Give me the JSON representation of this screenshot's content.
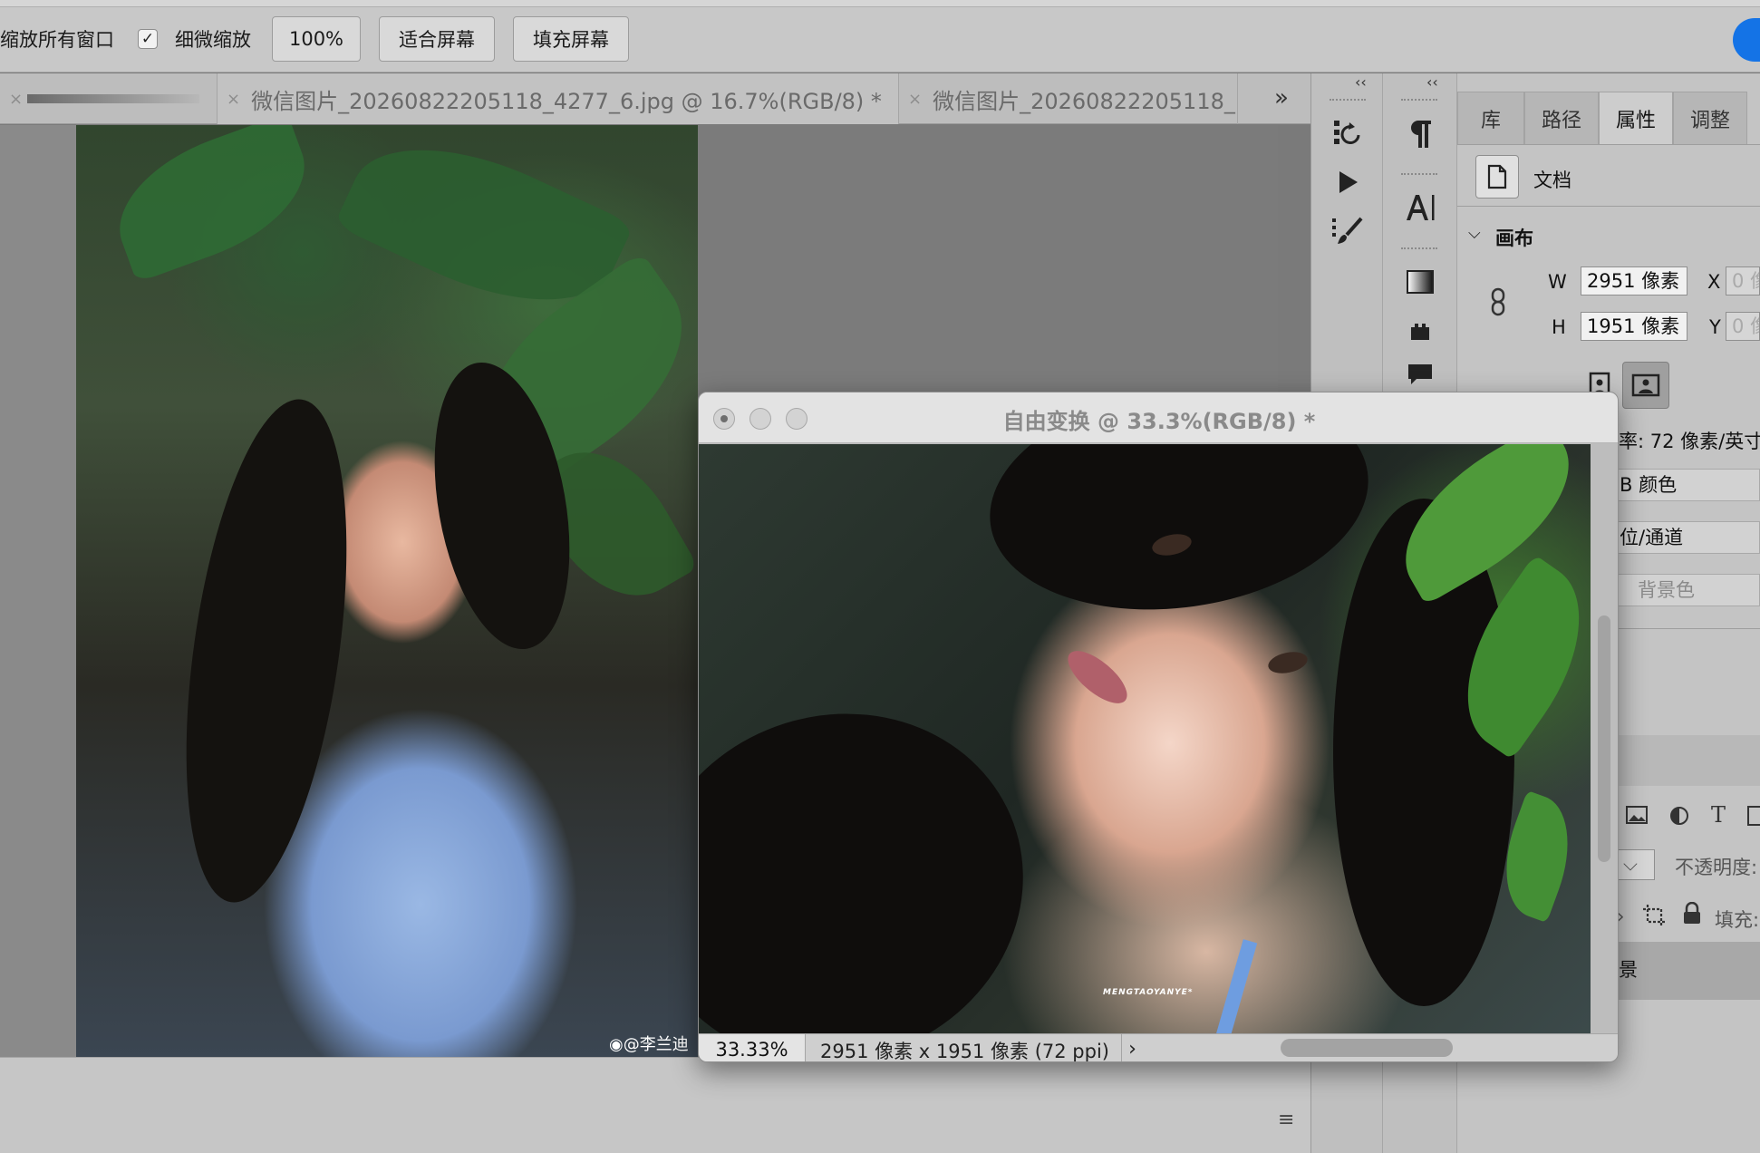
{
  "options_bar": {
    "zoom_all_windows": "缩放所有窗口",
    "scrubby_zoom_checked": "✓",
    "scrubby_zoom": "细微缩放",
    "zoom_100": "100%",
    "fit_screen": "适合屏幕",
    "fill_screen": "填充屏幕"
  },
  "tabs": [
    {
      "close": "×",
      "title": ""
    },
    {
      "close": "×",
      "title": "微信图片_20260822205118_4277_6.jpg @ 16.7%(RGB/8) *"
    },
    {
      "close": "×",
      "title": "微信图片_20260822205118_"
    }
  ],
  "tabs_overflow": "»",
  "document": {
    "watermark": "◉@李兰迪"
  },
  "dock": {
    "collapse_left": "‹‹",
    "collapse_right": "‹‹",
    "icons": [
      "history-icon",
      "actions-play-icon",
      "brush-presets-icon",
      "paragraph-icon",
      "character-icon",
      "gradient-icon",
      "tool-presets-icon",
      "comments-icon"
    ]
  },
  "properties_panel": {
    "tabs": [
      "库",
      "路径",
      "属性",
      "调整"
    ],
    "active_tab": "属性",
    "doc_label": "文档",
    "canvas_section": "画布",
    "w_label": "W",
    "w_value": "2951 像素",
    "h_label": "H",
    "h_value": "1951 像素",
    "x_label": "X",
    "x_value": "0 像",
    "y_label": "Y",
    "y_value": "0 像",
    "resolution": "率: 72 像素/英寸",
    "mode": "B 颜色",
    "depth": "位/通道",
    "fill": "背景色",
    "opacity_label": "不透明度:",
    "fill_label": "填充:",
    "layer_name": "景"
  },
  "floating_window": {
    "title": "自由变换 @ 33.3%(RGB/8) *",
    "watermark": "MENGTAOYANYE*",
    "zoom": "33.33%",
    "info": "2951 像素 x 1951 像素 (72 ppi)",
    "arrow": "›"
  },
  "status_menu": "≡",
  "colors": {
    "accent": "#1473e6",
    "panel_bg": "#c4c4c4",
    "canvas_bg": "#7b7b7b"
  }
}
